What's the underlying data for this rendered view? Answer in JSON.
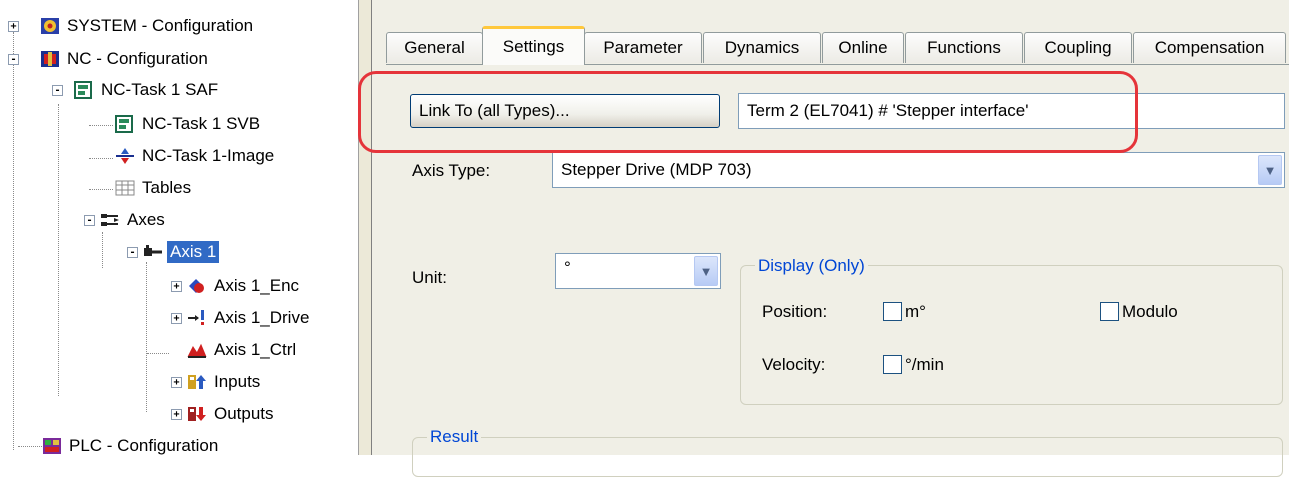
{
  "tree": {
    "items": [
      {
        "label": "SYSTEM - Configuration",
        "icon": "system-config-icon",
        "expander": "+"
      },
      {
        "label": "NC - Configuration",
        "icon": "nc-config-icon",
        "expander": "-"
      },
      {
        "label": "NC-Task 1 SAF",
        "icon": "task-icon",
        "expander": "-"
      },
      {
        "label": "NC-Task 1 SVB",
        "icon": "task-icon",
        "expander": ""
      },
      {
        "label": "NC-Task 1-Image",
        "icon": "image-icon",
        "expander": ""
      },
      {
        "label": "Tables",
        "icon": "table-icon",
        "expander": ""
      },
      {
        "label": "Axes",
        "icon": "axes-icon",
        "expander": "-"
      },
      {
        "label": "Axis 1",
        "icon": "axis-icon",
        "expander": "-",
        "selected": true
      },
      {
        "label": "Axis 1_Enc",
        "icon": "encoder-icon",
        "expander": "+"
      },
      {
        "label": "Axis 1_Drive",
        "icon": "drive-icon",
        "expander": "+"
      },
      {
        "label": "Axis 1_Ctrl",
        "icon": "controller-icon",
        "expander": ""
      },
      {
        "label": "Inputs",
        "icon": "inputs-icon",
        "expander": "+"
      },
      {
        "label": "Outputs",
        "icon": "outputs-icon",
        "expander": "+"
      },
      {
        "label": "PLC - Configuration",
        "icon": "plc-config-icon",
        "expander": ""
      }
    ]
  },
  "tabs": [
    {
      "label": "General"
    },
    {
      "label": "Settings",
      "active": true
    },
    {
      "label": "Parameter"
    },
    {
      "label": "Dynamics"
    },
    {
      "label": "Online"
    },
    {
      "label": "Functions"
    },
    {
      "label": "Coupling"
    },
    {
      "label": "Compensation"
    }
  ],
  "settings": {
    "link_button": "Link To (all Types)...",
    "link_value": "Term 2 (EL7041) # 'Stepper interface'",
    "axis_type_label": "Axis Type:",
    "axis_type_value": "Stepper Drive (MDP 703)",
    "unit_label": "Unit:",
    "unit_value": "°",
    "display_group_title": "Display (Only)",
    "position_label": "Position:",
    "position_unit": "m°",
    "modulo_label": "Modulo",
    "velocity_label": "Velocity:",
    "velocity_unit": "°/min",
    "result_group_title": "Result"
  },
  "colors": {
    "selection": "#316ac5",
    "group_title": "#0046d5",
    "annotation": "#e5343a",
    "active_tab_accent": "#ffc83c"
  }
}
